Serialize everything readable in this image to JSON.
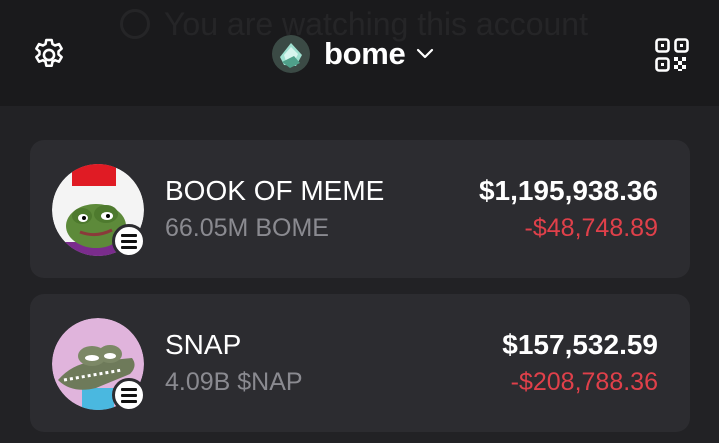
{
  "header": {
    "watermark": "You are watching this account",
    "account_name": "bome",
    "icons": {
      "settings": "gear-icon",
      "dropdown": "chevron-down-icon",
      "qr": "qr-code-icon",
      "watch": "eye-icon"
    }
  },
  "tokens": [
    {
      "name": "BOOK OF MEME",
      "amount": "66.05M BOME",
      "value": "$1,195,938.36",
      "change": "-$48,748.89",
      "chain_icon": "solana-icon"
    },
    {
      "name": "SNAP",
      "amount": "4.09B $NAP",
      "value": "$157,532.59",
      "change": "-$208,788.36",
      "chain_icon": "solana-icon"
    }
  ],
  "colors": {
    "background": "#222225",
    "header_bg": "#1a1a1c",
    "card_bg": "#2c2c30",
    "secondary_text": "#8a8a90",
    "negative": "#e0404a"
  }
}
